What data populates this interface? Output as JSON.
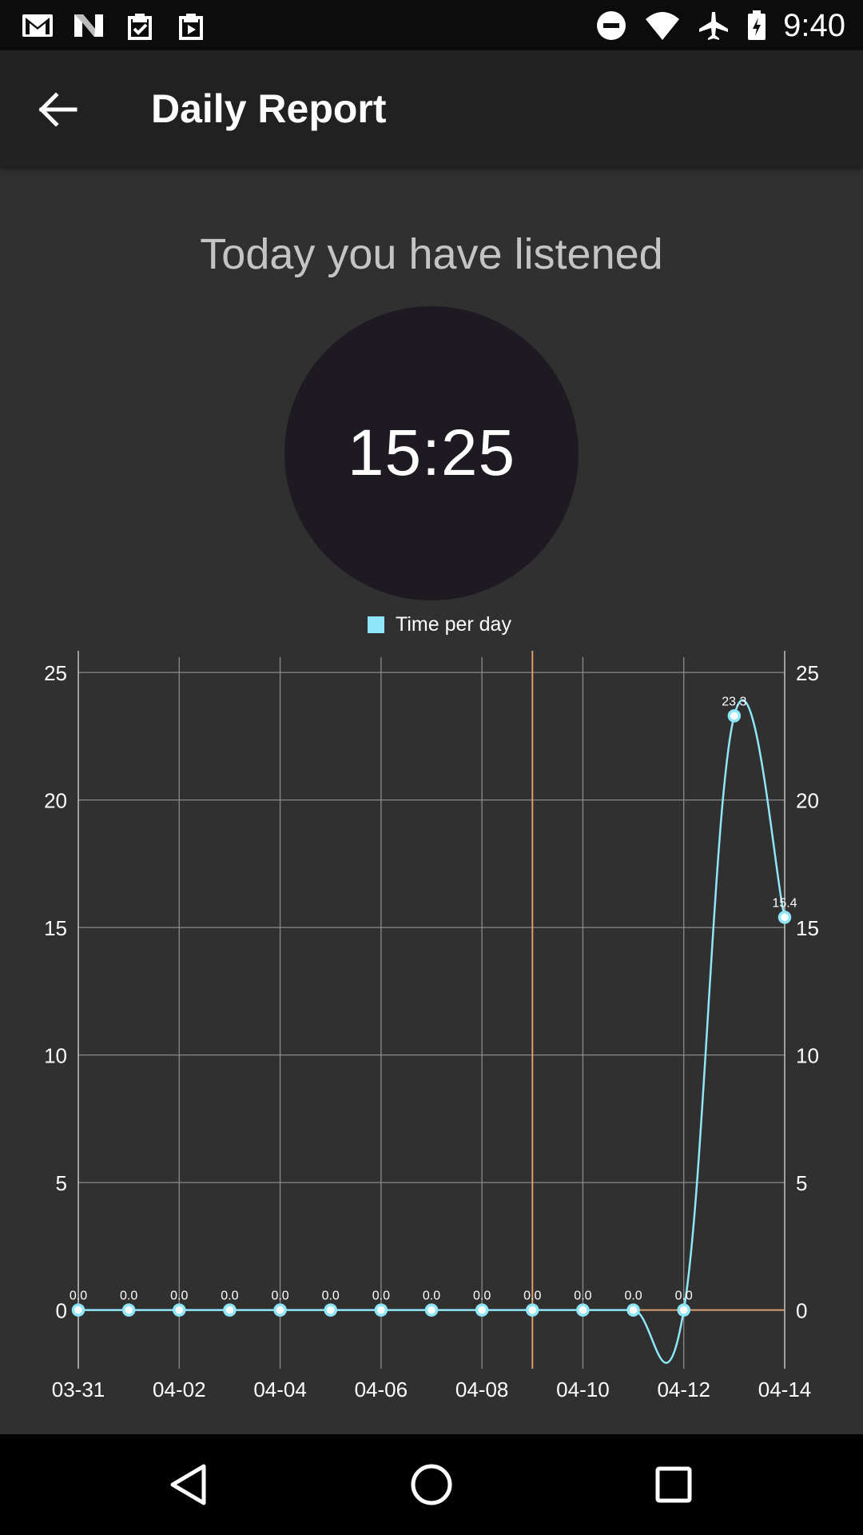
{
  "status_bar": {
    "time": "9:40",
    "left_icons": [
      "gmail-icon",
      "n-logo-icon",
      "clipboard-check-icon",
      "clipboard-play-icon"
    ],
    "right_icons": [
      "do-not-disturb-icon",
      "wifi-icon",
      "airplane-icon",
      "battery-charging-icon"
    ]
  },
  "app_bar": {
    "title": "Daily Report",
    "back_icon": "arrow-back-icon"
  },
  "content": {
    "headline": "Today you have listened",
    "timer": "15:25"
  },
  "chart_data": {
    "type": "line",
    "series": [
      {
        "name": "Time per day",
        "color": "#8fe6f8",
        "x": [
          "03-31",
          "04-01",
          "04-02",
          "04-03",
          "04-04",
          "04-05",
          "04-06",
          "04-07",
          "04-08",
          "04-09",
          "04-10",
          "04-11",
          "04-12",
          "04-13",
          "04-14"
        ],
        "values": [
          0,
          0,
          0,
          0,
          0,
          0,
          0,
          0,
          0,
          0,
          0,
          0,
          0,
          23.3,
          15.4
        ],
        "labels": [
          "0.0",
          "0.0",
          "0.0",
          "0.0",
          "0.0",
          "0.0",
          "0.0",
          "0.0",
          "0.0",
          "0.0",
          "0.0",
          "0.0",
          "0.0",
          "23.3",
          "15.4"
        ]
      }
    ],
    "x_tick_labels": [
      "03-31",
      "04-02",
      "04-04",
      "04-06",
      "04-08",
      "04-10",
      "04-12",
      "04-14"
    ],
    "y_ticks": [
      0,
      5,
      10,
      15,
      20,
      25
    ],
    "y_tick_labels": [
      "0",
      "5",
      "10",
      "15",
      "20",
      "25"
    ],
    "ylim": [
      -2.3,
      25.6
    ],
    "grid": true,
    "dual_y_axis": true,
    "highlight_x": "04-09",
    "highlight_color": "#d9a070",
    "legend_position": "top-center"
  },
  "nav_bar": {
    "back": "nav-back-icon",
    "home": "nav-home-icon",
    "recents": "nav-recents-icon"
  }
}
